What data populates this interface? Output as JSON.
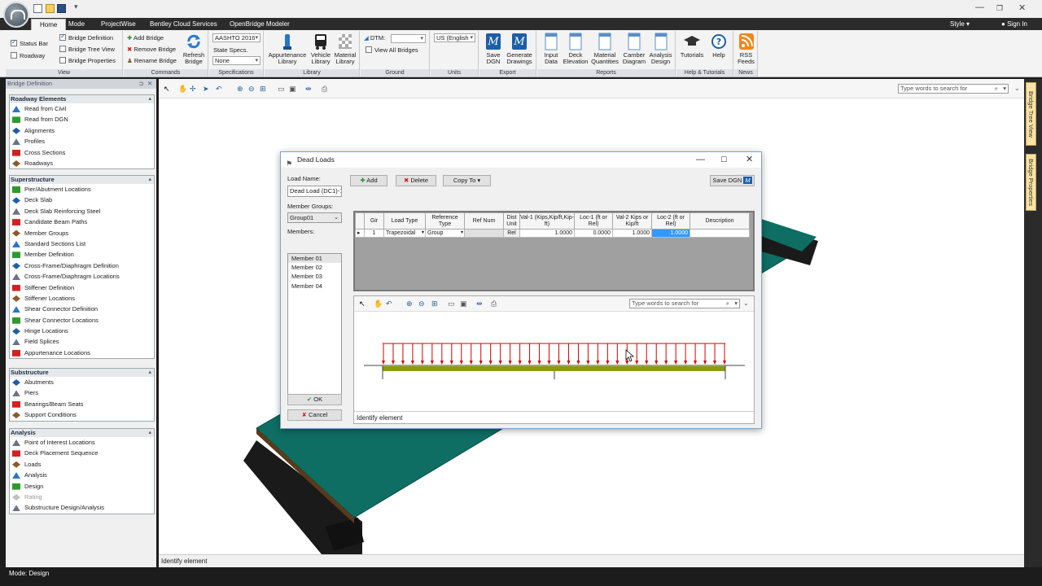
{
  "colors": {
    "accent": "#1a57a6",
    "deck": "#0e6e63",
    "girder": "#8c9a12",
    "load": "#d40000",
    "selection": "#3399ff"
  },
  "titlebar": {
    "style_label": "Style",
    "signin_label": "Sign In",
    "tabs": [
      "Home",
      "Mode",
      "ProjectWise",
      "Bentley Cloud Services",
      "OpenBridge Modeler"
    ]
  },
  "ribbon": {
    "view": {
      "label": "View",
      "status_bar": "Status Bar",
      "roadway": "Roadway",
      "bridge_definition": "Bridge Definition",
      "bridge_tree_view": "Bridge Tree View",
      "bridge_properties": "Bridge Properties"
    },
    "commands": {
      "label": "Commands",
      "add_bridge": "Add Bridge",
      "remove_bridge": "Remove Bridge",
      "rename_bridge": "Rename Bridge",
      "refresh_bridge": "Refresh Bridge"
    },
    "specifications": {
      "label": "Specifications",
      "spec_value": "AASHTO 2016",
      "state_specs_label": "State Specs.",
      "state_specs_value": "None"
    },
    "library": {
      "label": "Library",
      "appurtenance": "Appurtenance Library",
      "vehicle": "Vehicle Library",
      "material": "Material Library"
    },
    "ground": {
      "label": "Ground",
      "dtm": "DTM:",
      "view_all_bridges": "View All Bridges"
    },
    "units": {
      "label": "Units",
      "value": "US (English"
    },
    "export": {
      "label": "Export",
      "save_dgn": "Save DGN",
      "generate_drawings": "Generate Drawings"
    },
    "reports": {
      "label": "Reports",
      "input_data": "Input Data",
      "deck_elevation": "Deck Elevation",
      "material_quantities": "Material Quantities",
      "camber_diagram": "Camber Diagram",
      "analysis_design": "Analysis Design"
    },
    "help": {
      "label": "Help & Tutorials",
      "tutorials": "Tutorials",
      "help": "Help"
    },
    "news": {
      "label": "News",
      "rss": "RSS Feeds"
    }
  },
  "left_panel": {
    "title": "Bridge Definition",
    "sections": [
      {
        "title": "Roadway Elements",
        "items": [
          {
            "label": "Read from Civil",
            "icon": "import-icon"
          },
          {
            "label": "Read from DGN",
            "icon": "import-icon"
          },
          {
            "label": "Alignments",
            "icon": "alignment-icon"
          },
          {
            "label": "Profiles",
            "icon": "profile-icon"
          },
          {
            "label": "Cross Sections",
            "icon": "cross-section-icon"
          },
          {
            "label": "Roadways",
            "icon": "roadway-icon"
          }
        ]
      },
      {
        "title": "Superstructure",
        "items": [
          {
            "label": "Pier/Abutment Locations",
            "icon": "pier-location-icon"
          },
          {
            "label": "Deck Slab",
            "icon": "deck-slab-icon"
          },
          {
            "label": "Deck Slab Reinforcing Steel",
            "icon": "reinforcing-icon"
          },
          {
            "label": "Candidate Beam Paths",
            "icon": "beam-path-icon"
          },
          {
            "label": "Member Groups",
            "icon": "member-group-icon"
          },
          {
            "label": "Standard Sections List",
            "icon": "section-list-icon"
          },
          {
            "label": "Member Definition",
            "icon": "member-icon"
          },
          {
            "label": "Cross-Frame/Diaphragm Definition",
            "icon": "cross-frame-icon"
          },
          {
            "label": "Cross-Frame/Diaphragm Locations",
            "icon": "cross-frame-location-icon"
          },
          {
            "label": "Stiffener Definition",
            "icon": "stiffener-icon"
          },
          {
            "label": "Stiffener Locations",
            "icon": "stiffener-location-icon"
          },
          {
            "label": "Shear Connector Definition",
            "icon": "shear-connector-icon"
          },
          {
            "label": "Shear Connector Locations",
            "icon": "shear-connector-location-icon"
          },
          {
            "label": "Hinge Locations",
            "icon": "hinge-icon"
          },
          {
            "label": "Field Splices",
            "icon": "splice-icon"
          },
          {
            "label": "Appurtenance Locations",
            "icon": "appurtenance-icon"
          }
        ]
      },
      {
        "title": "Substructure",
        "items": [
          {
            "label": "Abutments",
            "icon": "abutment-icon"
          },
          {
            "label": "Piers",
            "icon": "pier-icon"
          },
          {
            "label": "Bearings/Beam Seats",
            "icon": "bearing-icon"
          },
          {
            "label": "Support Conditions",
            "icon": "support-icon"
          }
        ]
      },
      {
        "title": "Analysis",
        "items": [
          {
            "label": "Point of Interest Locations",
            "icon": "poi-icon"
          },
          {
            "label": "Deck Placement Sequence",
            "icon": "sequence-icon"
          },
          {
            "label": "Loads",
            "icon": "loads-icon"
          },
          {
            "label": "Analysis",
            "icon": "analysis-icon"
          },
          {
            "label": "Design",
            "icon": "design-icon"
          },
          {
            "label": "Rating",
            "icon": "rating-icon",
            "disabled": true
          },
          {
            "label": "Substructure Design/Analysis",
            "icon": "substructure-design-icon"
          }
        ]
      }
    ]
  },
  "viewport": {
    "search_placeholder": "Type words to search for",
    "status": "Identify element"
  },
  "right_rail": {
    "tree_view": "Bridge Tree View",
    "properties": "Bridge Properties"
  },
  "mode_bar": "Mode: Design",
  "dialog": {
    "title": "Dead Loads",
    "load_name_label": "Load Name:",
    "load_name_value": "Dead Load (DC1)-1",
    "member_groups_label": "Member Groups:",
    "member_group_value": "Group01",
    "members_label": "Members:",
    "members": [
      "Member 01",
      "Member 02",
      "Member 03",
      "Member 04"
    ],
    "ok": "OK",
    "cancel": "Cancel",
    "add": "Add",
    "delete": "Delete",
    "copy_to": "Copy To",
    "save_dgn": "Save DGN",
    "table": {
      "headers": [
        "Gir",
        "Load Type",
        "Reference Type",
        "Ref Num",
        "Dist Unit",
        "Val-1 (Kips,Kip/ft,Kip-ft)",
        "Loc-1 (ft or Rel)",
        "Val-2 Kips or Kip/ft",
        "Loc-2 (ft or Rel)",
        "Description"
      ],
      "row": [
        "1",
        "Trapezoidal",
        "Group",
        "",
        "Rel",
        "1.0000",
        "0.0000",
        "1.0000",
        "1.0000",
        ""
      ]
    },
    "viewer": {
      "search_placeholder": "Type words to search for",
      "status": "Identify element"
    },
    "diagram": {
      "load_arrows": 36
    }
  }
}
